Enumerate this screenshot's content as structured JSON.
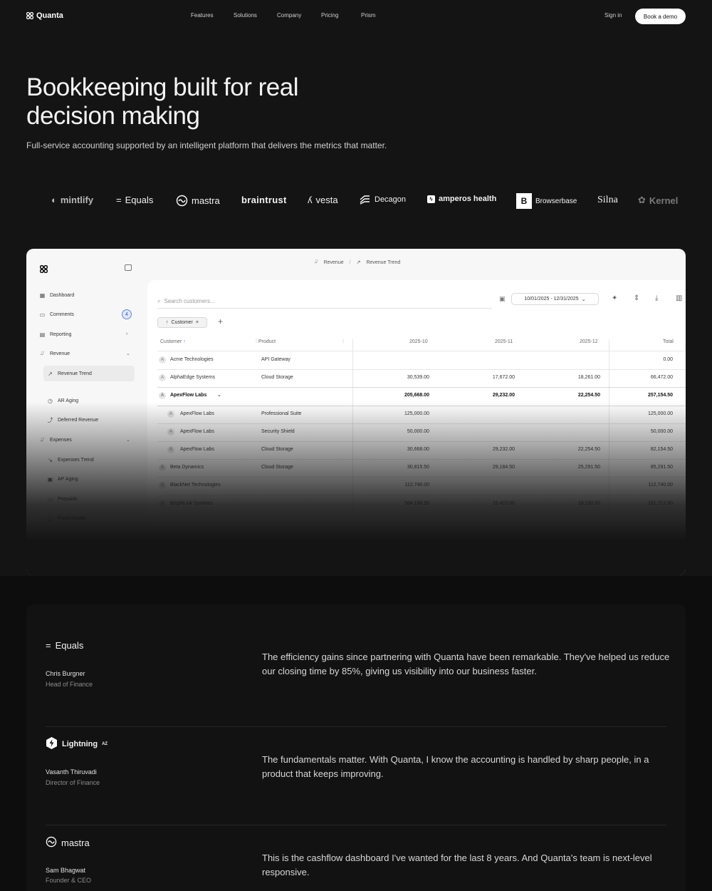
{
  "nav": {
    "brand": "Quanta",
    "links": [
      "Features",
      "Solutions",
      "Company",
      "Pricing",
      "Prism"
    ],
    "sign_in": "Sign in",
    "demo": "Book a demo"
  },
  "hero": {
    "title_line1": "Bookkeeping built for real",
    "title_line2": "decision making",
    "subtitle": "Full-service accounting supported by an intelligent platform that delivers the metrics that matter."
  },
  "logos": [
    "mintlify",
    "Equals",
    "mastra",
    "braintrust",
    "vesta",
    "Decagon",
    "amperos health",
    "Browserbase",
    "Silna",
    "Kernel"
  ],
  "app": {
    "breadcrumb": [
      "Revenue",
      "/",
      "Revenue Trend"
    ],
    "sidebar": [
      {
        "label": "Dashboard"
      },
      {
        "label": "Comments",
        "badge": "4"
      },
      {
        "label": "Reporting"
      },
      {
        "label": "Revenue"
      },
      {
        "label": "Revenue Trend"
      },
      {
        "label": "AR Aging"
      },
      {
        "label": "Deferred Revenue"
      },
      {
        "label": "Expenses"
      },
      {
        "label": "Expenses Trend"
      },
      {
        "label": "AP Aging"
      },
      {
        "label": "Prepaids"
      },
      {
        "label": "Fixed Assets"
      }
    ],
    "search_placeholder": "Search customers...",
    "date_range": "10/01/2025 - 12/31/2025",
    "filter_chip": "Customer",
    "table": {
      "headers": [
        "Customer",
        "Product",
        "2025-10",
        "2025-11",
        "2025-12",
        "Total"
      ],
      "rows": [
        {
          "customer": "Acme Technologies",
          "product": "API Gateway",
          "v": [
            "",
            "",
            "",
            "0.00"
          ]
        },
        {
          "customer": "AlphaEdge Systems",
          "product": "Cloud Storage",
          "v": [
            "30,539.00",
            "17,672.00",
            "18,261.00",
            "66,472.00"
          ]
        },
        {
          "customer": "ApexFlow Labs",
          "product": "",
          "v": [
            "205,668.00",
            "29,232.00",
            "22,254.50",
            "257,154.50"
          ],
          "bold": true
        },
        {
          "customer": "ApexFlow Labs",
          "product": "Professional Suite",
          "v": [
            "125,000.00",
            "",
            "",
            "125,000.00"
          ],
          "sub": true
        },
        {
          "customer": "ApexFlow Labs",
          "product": "Security Shield",
          "v": [
            "50,000.00",
            "",
            "",
            "50,000.00"
          ],
          "sub": true
        },
        {
          "customer": "ApexFlow Labs",
          "product": "Cloud Storage",
          "v": [
            "30,668.00",
            "29,232.00",
            "22,254.50",
            "82,154.50"
          ],
          "sub": true
        },
        {
          "customer": "Beta Dynamics",
          "product": "Cloud Storage",
          "v": [
            "30,815.50",
            "29,184.50",
            "25,291.50",
            "85,291.50"
          ]
        },
        {
          "customer": "BlackNet Technologies",
          "product": "",
          "v": [
            "112,740.00",
            "",
            "",
            "112,740.00"
          ]
        },
        {
          "customer": "BrightLink Systems",
          "product": "",
          "v": [
            "584,188.50",
            "15,423.00",
            "18,100.00",
            "161,712.00"
          ]
        }
      ]
    }
  },
  "testimonials": [
    {
      "company": "Equals",
      "name": "Chris Burgner",
      "role": "Head of Finance",
      "quote": "The efficiency gains since partnering with Quanta have been remarkable. They've helped us reduce our closing time by 85%, giving us visibility into our business faster."
    },
    {
      "company": "Lightning",
      "company_sup": "AZ",
      "name": "Vasanth Thiruvadi",
      "role": "Director of Finance",
      "quote": "The fundamentals matter. With Quanta, I know the accounting is handled by sharp people, in a product that keeps improving."
    },
    {
      "company": "mastra",
      "name": "Sam Bhagwat",
      "role": "Founder & CEO",
      "quote": "This is the cashflow dashboard I've wanted for the last 8 years. And Quanta's team is next-level responsive."
    }
  ]
}
